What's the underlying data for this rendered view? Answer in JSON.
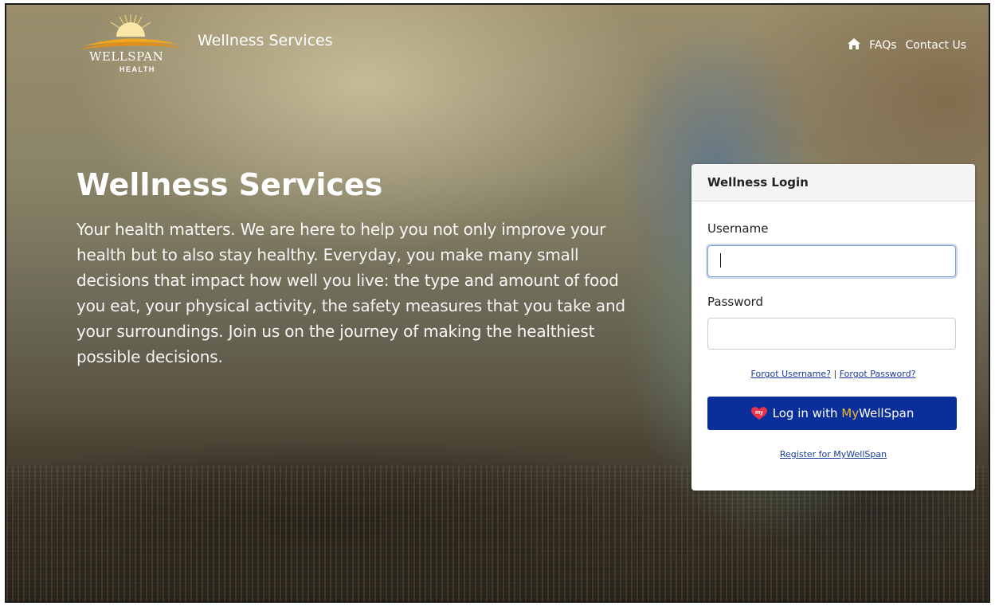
{
  "brand": {
    "wordmark": "WELLSPAN",
    "subtitle": "HEALTH",
    "site_title": "Wellness Services"
  },
  "nav": {
    "home_icon": "home-icon",
    "items": [
      {
        "label": "FAQs"
      },
      {
        "label": "Contact Us"
      }
    ]
  },
  "hero": {
    "title": "Wellness Services",
    "description": "Your health matters. We are here to help you not only improve your health but to also stay healthy. Everyday, you make many small decisions that impact how well you live: the type and amount of food you eat, your physical activity, the safety measures that you take and your surroundings. Join us on the journey of making the healthiest possible decisions."
  },
  "login": {
    "header": "Wellness Login",
    "username_label": "Username",
    "username_value": "",
    "password_label": "Password",
    "password_value": "",
    "forgot_username": "Forgot Username?",
    "separator": "|",
    "forgot_password": "Forgot Password?",
    "button_prefix": "Log in with ",
    "button_my": "My",
    "button_suffix": "WellSpan",
    "button_icon_text": "my",
    "register": "Register for MyWellSpan"
  },
  "colors": {
    "button_bg": "#0b2f9a",
    "my_accent": "#f4b731",
    "heart": "#e8334a",
    "logo_sun": "#f2a81d"
  }
}
